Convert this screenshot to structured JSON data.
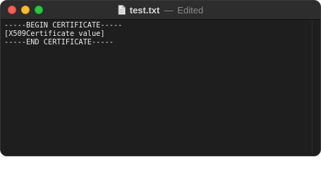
{
  "window": {
    "title": "test.txt",
    "separator": "—",
    "status": "Edited"
  },
  "editor": {
    "lines": [
      "-----BEGIN CERTIFICATE-----",
      "[X509Certificate value]",
      "-----END CERTIFICATE-----"
    ]
  },
  "colors": {
    "background": "#1e1e1e",
    "titlebar": "#2d2d2d",
    "close": "#ff5f57",
    "minimize": "#febc2e",
    "zoom": "#28c840"
  },
  "icons": {
    "document": "document-icon"
  }
}
